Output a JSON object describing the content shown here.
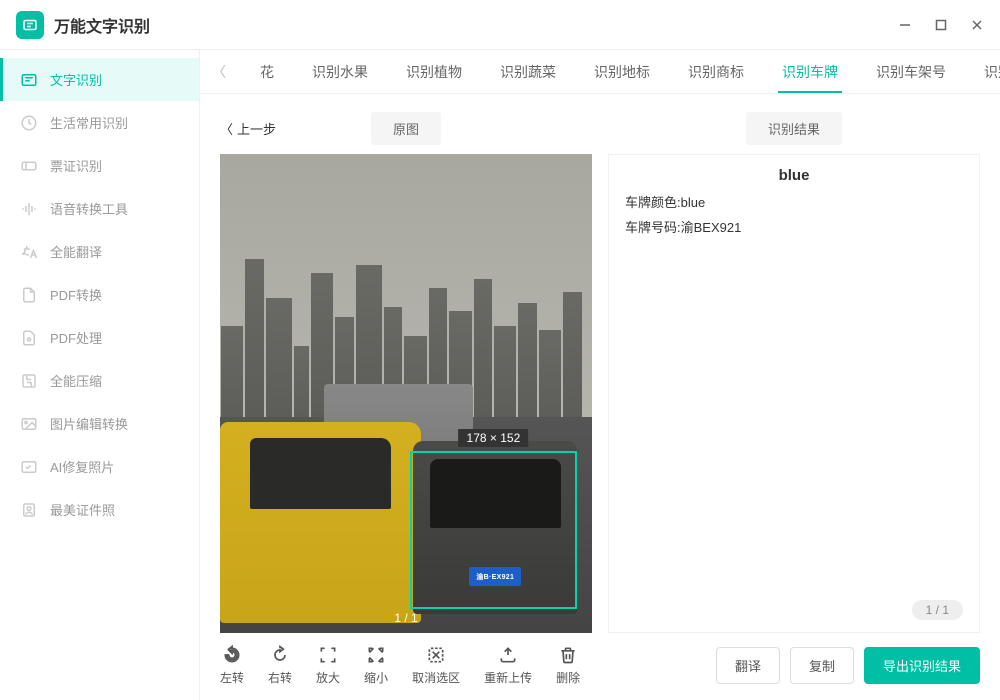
{
  "app": {
    "title": "万能文字识别"
  },
  "window_controls": {
    "min": "−",
    "max": "□",
    "close": "✕"
  },
  "sidebar": {
    "items": [
      {
        "label": "文字识别",
        "active": true
      },
      {
        "label": "生活常用识别"
      },
      {
        "label": "票证识别"
      },
      {
        "label": "语音转换工具"
      },
      {
        "label": "全能翻译"
      },
      {
        "label": "PDF转换"
      },
      {
        "label": "PDF处理"
      },
      {
        "label": "全能压缩"
      },
      {
        "label": "图片编辑转换"
      },
      {
        "label": "AI修复照片"
      },
      {
        "label": "最美证件照"
      }
    ]
  },
  "tabs": {
    "items": [
      {
        "label": "花"
      },
      {
        "label": "识别水果"
      },
      {
        "label": "识别植物"
      },
      {
        "label": "识别蔬菜"
      },
      {
        "label": "识别地标"
      },
      {
        "label": "识别商标"
      },
      {
        "label": "识别车牌",
        "active": true
      },
      {
        "label": "识别车架号"
      },
      {
        "label": "识别车型"
      }
    ]
  },
  "workspace": {
    "back_label": "上一步",
    "left_title": "原图",
    "right_title": "识别结果",
    "crop": {
      "label": "178 × 152",
      "page": "1 / 1"
    },
    "plate_text": "渝B·EX921",
    "result": {
      "title": "blue",
      "line1": "车牌颜色:blue",
      "line2": "车牌号码:渝BEX921",
      "pager": "1 / 1"
    }
  },
  "tools": {
    "items": [
      {
        "name": "rotate-left",
        "label": "左转"
      },
      {
        "name": "rotate-right",
        "label": "右转"
      },
      {
        "name": "zoom-in",
        "label": "放大"
      },
      {
        "name": "zoom-out",
        "label": "缩小"
      },
      {
        "name": "clear-selection",
        "label": "取消选区"
      },
      {
        "name": "reupload",
        "label": "重新上传"
      },
      {
        "name": "delete",
        "label": "删除"
      }
    ]
  },
  "actions": {
    "translate": "翻译",
    "copy": "复制",
    "export": "导出识别结果"
  }
}
